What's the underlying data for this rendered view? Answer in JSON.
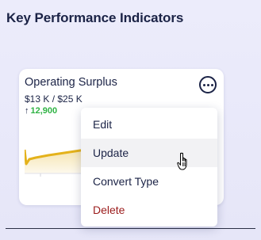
{
  "section": {
    "title": "Key Performance Indicators"
  },
  "kpi_card": {
    "title": "Operating Surplus",
    "value_text": "$13 K / $25 K",
    "trend": {
      "direction": "up",
      "arrow": "↑",
      "value": "12,900"
    },
    "more_icon": "more-horizontal-icon",
    "sparkline_color": "#e4b21b"
  },
  "context_menu": {
    "items": [
      {
        "label": "Edit",
        "hovered": false
      },
      {
        "label": "Update",
        "hovered": true
      },
      {
        "label": "Convert Type",
        "hovered": false
      },
      {
        "label": "Delete",
        "hovered": false,
        "danger": true
      }
    ]
  },
  "colors": {
    "text_primary": "#1b2346",
    "trend_positive": "#2fb344",
    "danger": "#9b1c1c",
    "panel_bg": "#e8e8f9"
  },
  "cursor": "hand-pointer-icon"
}
